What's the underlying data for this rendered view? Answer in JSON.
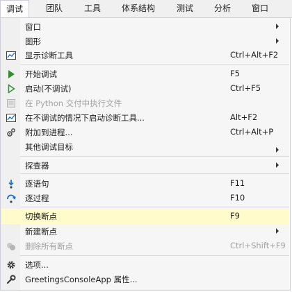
{
  "menubar": {
    "items": [
      "调试",
      "团队",
      "工具",
      "体系结构",
      "测试",
      "分析",
      "窗口"
    ]
  },
  "menu": {
    "items": [
      {
        "label": "窗口",
        "shortcut": "",
        "icon": "",
        "submenu": true,
        "disabled": false
      },
      {
        "label": "图形",
        "shortcut": "",
        "icon": "",
        "submenu": true,
        "disabled": false
      },
      {
        "label": "显示诊断工具",
        "shortcut": "Ctrl+Alt+F2",
        "icon": "diagnostic-tools-icon",
        "submenu": false,
        "disabled": false
      },
      {
        "label": "开始调试",
        "shortcut": "F5",
        "icon": "play-icon",
        "submenu": false,
        "disabled": false
      },
      {
        "label": "启动(不调试)",
        "shortcut": "Ctrl+F5",
        "icon": "play-outline-icon",
        "submenu": false,
        "disabled": false
      },
      {
        "label": "在 Python 交付中执行文件",
        "shortcut": "",
        "icon": "python-file-icon",
        "submenu": false,
        "disabled": true
      },
      {
        "label": "在不调试的情况下启动诊断工具...",
        "shortcut": "Alt+F2",
        "icon": "diagnostic-tools-icon",
        "submenu": false,
        "disabled": false
      },
      {
        "label": "附加到进程...",
        "shortcut": "Ctrl+Alt+P",
        "icon": "attach-process-icon",
        "submenu": false,
        "disabled": false
      },
      {
        "label": "其他调试目标",
        "shortcut": "",
        "icon": "",
        "submenu": true,
        "disabled": false
      },
      {
        "label": "探查器",
        "shortcut": "",
        "icon": "",
        "submenu": true,
        "disabled": false
      },
      {
        "label": "逐语句",
        "shortcut": "F11",
        "icon": "step-into-icon",
        "submenu": false,
        "disabled": false
      },
      {
        "label": "逐过程",
        "shortcut": "F10",
        "icon": "step-over-icon",
        "submenu": false,
        "disabled": false
      },
      {
        "label": "切换断点",
        "shortcut": "F9",
        "icon": "",
        "submenu": false,
        "disabled": false,
        "highlighted": true
      },
      {
        "label": "新建断点",
        "shortcut": "",
        "icon": "",
        "submenu": true,
        "disabled": false
      },
      {
        "label": "删除所有断点",
        "shortcut": "Ctrl+Shift+F9",
        "icon": "delete-breakpoints-icon",
        "submenu": false,
        "disabled": true
      },
      {
        "label": "选项...",
        "shortcut": "",
        "icon": "gear-icon",
        "submenu": false,
        "disabled": false
      },
      {
        "label": "GreetingsConsoleApp 属性...",
        "shortcut": "",
        "icon": "wrench-icon",
        "submenu": false,
        "disabled": false
      }
    ]
  },
  "colors": {
    "highlight": "#fffbcb",
    "green": "#388a34",
    "blue": "#1e6fc4",
    "disabled": "#a2a2a2"
  }
}
